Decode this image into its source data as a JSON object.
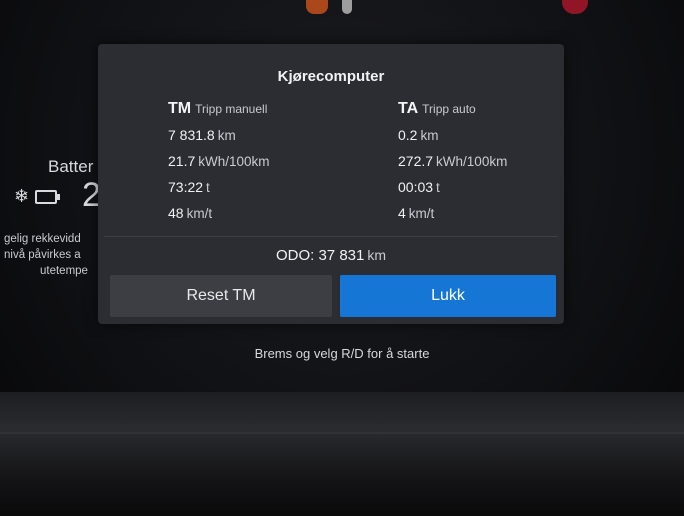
{
  "left_cluster": {
    "battery_label": "Batter",
    "range_digits": "2",
    "snow_icon": "snowflake-icon",
    "battery_icon": "battery-icon",
    "line1": "gelig rekkevidd",
    "line2": "nivå påvirkes a",
    "line3": "utetempe"
  },
  "dialog": {
    "title": "Kjørecomputer",
    "tm": {
      "code": "TM",
      "name": "Tripp manuell",
      "distance": {
        "value": "7 831.8",
        "unit": "km"
      },
      "consumption": {
        "value": "21.7",
        "unit": "kWh/100km"
      },
      "time": {
        "value": "73:22",
        "unit": "t"
      },
      "speed": {
        "value": "48",
        "unit": "km/t"
      }
    },
    "ta": {
      "code": "TA",
      "name": "Tripp auto",
      "distance": {
        "value": "0.2",
        "unit": "km"
      },
      "consumption": {
        "value": "272.7",
        "unit": "kWh/100km"
      },
      "time": {
        "value": "00:03",
        "unit": "t"
      },
      "speed": {
        "value": "4",
        "unit": "km/t"
      }
    },
    "odo": {
      "label": "ODO:",
      "value": "37 831",
      "unit": "km"
    },
    "buttons": {
      "reset": "Reset TM",
      "close": "Lukk"
    },
    "colors": {
      "dialog_bg": "#2b2d32",
      "close_button": "#1676d6",
      "reset_button": "#3c3e44"
    }
  },
  "hint": "Brems og velg R/D for å starte"
}
